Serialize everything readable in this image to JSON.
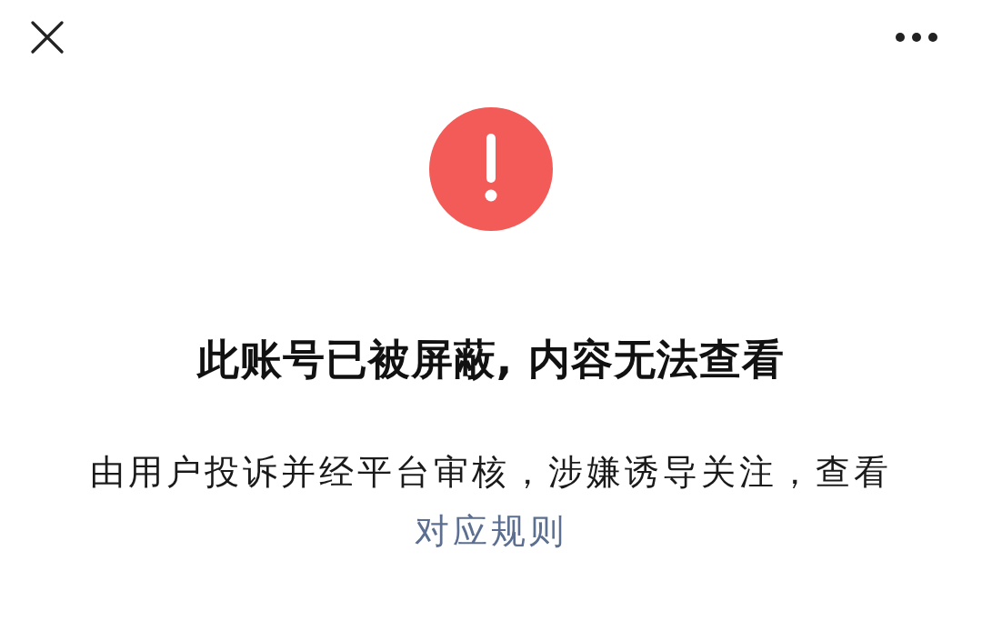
{
  "title": "此账号已被屏蔽, 内容无法查看",
  "message": {
    "text": "由用户投诉并经平台审核，涉嫌诱导关注，查看",
    "link": "对应规则"
  }
}
